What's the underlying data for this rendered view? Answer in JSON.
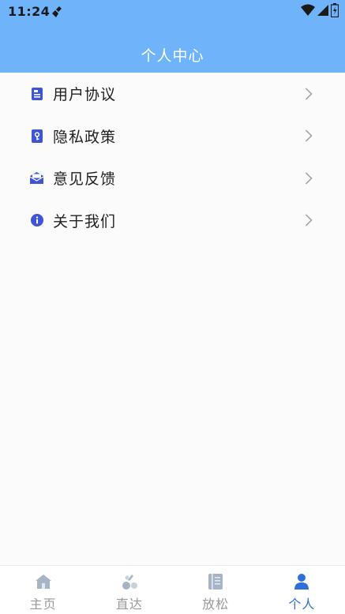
{
  "status_bar": {
    "time": "11:24",
    "icons": [
      "broom-icon",
      "wifi-icon",
      "signal-icon",
      "battery-icon"
    ]
  },
  "header": {
    "title": "个人中心",
    "background_color": "#6fb4fa"
  },
  "menu": {
    "items": [
      {
        "label": "用户协议",
        "icon": "document-icon"
      },
      {
        "label": "隐私政策",
        "icon": "key-lock-icon"
      },
      {
        "label": "意见反馈",
        "icon": "mail-icon"
      },
      {
        "label": "关于我们",
        "icon": "info-icon"
      }
    ],
    "icon_color": "#3d55d6"
  },
  "bottom_nav": {
    "items": [
      {
        "label": "主页",
        "icon": "home-icon",
        "active": false
      },
      {
        "label": "直达",
        "icon": "direct-icon",
        "active": false
      },
      {
        "label": "放松",
        "icon": "notebook-icon",
        "active": false
      },
      {
        "label": "个人",
        "icon": "person-icon",
        "active": true
      }
    ],
    "active_color": "#2e6fd8",
    "inactive_color": "#9a9a9a"
  }
}
